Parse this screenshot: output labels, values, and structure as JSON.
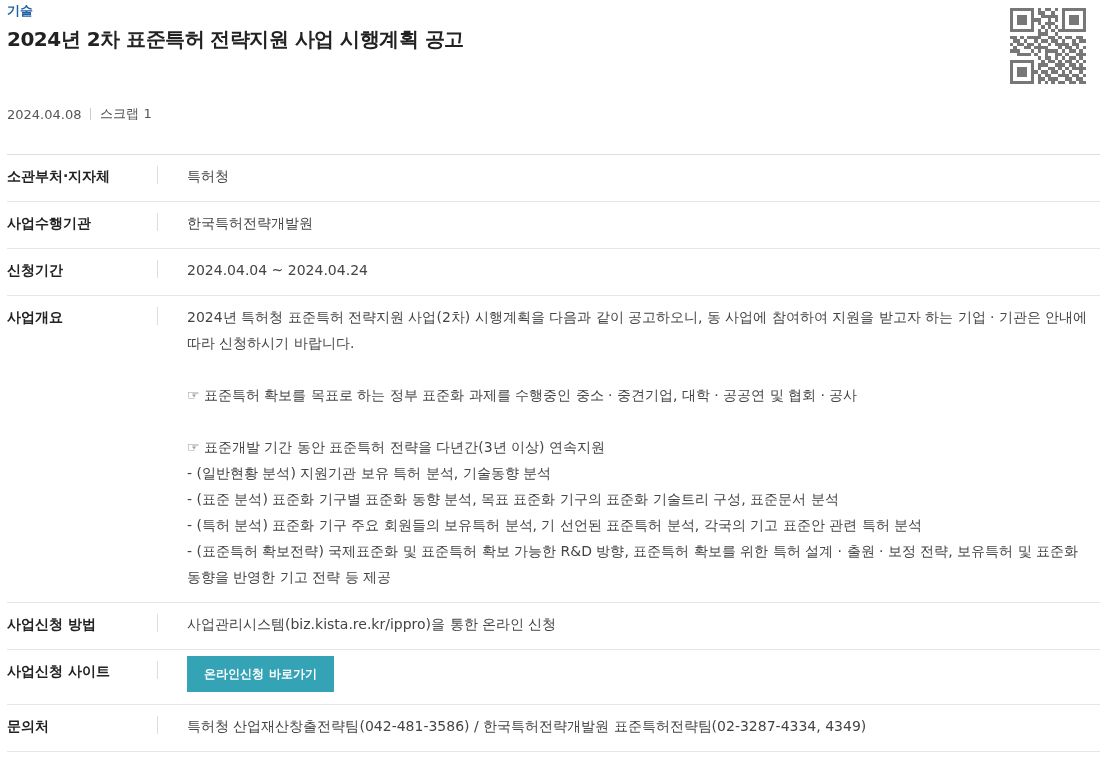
{
  "category": "기술",
  "title": "2024년 2차 표준특허 전략지원 사업 시행계획 공고",
  "date": "2024.04.08",
  "scrap": "스크랩 1",
  "rows": [
    {
      "kind": "text",
      "label": "소관부처·지자체",
      "blocks": [
        [
          "특허청"
        ]
      ]
    },
    {
      "kind": "text",
      "label": "사업수행기관",
      "blocks": [
        [
          "한국특허전략개발원"
        ]
      ]
    },
    {
      "kind": "text",
      "label": "신청기간",
      "blocks": [
        [
          "2024.04.04 ~ 2024.04.24"
        ]
      ]
    },
    {
      "kind": "text",
      "label": "사업개요",
      "blocks": [
        [
          "2024년 특허청 표준특허 전략지원 사업(2차) 시행계획을 다음과 같이 공고하오니, 동 사업에 참여하여 지원을 받고자 하는 기업 · 기관은 안내에 따라 신청하시기 바랍니다."
        ],
        [
          "☞ 표준특허 확보를 목표로 하는 정부 표준화 과제를 수행중인 중소 · 중견기업, 대학 · 공공연 및 협회 · 공사"
        ],
        [
          "☞ 표준개발 기간 동안 표준특허 전략을 다년간(3년 이상) 연속지원",
          "- (일반현황 분석) 지원기관 보유 특허 분석, 기술동향 분석",
          "- (표준 분석) 표준화 기구별 표준화 동향 분석, 목표 표준화 기구의 표준화 기술트리 구성, 표준문서 분석",
          "- (특허 분석) 표준화 기구 주요 회원들의 보유특허 분석, 기 선언된 표준특허 분석, 각국의 기고 표준안 관련 특허 분석",
          "- (표준특허 확보전략) 국제표준화 및 표준특허 확보 가능한 R&D 방향, 표준특허 확보를 위한 특허 설계 · 출원 · 보정 전략, 보유특허 및 표준화 동향을 반영한 기고 전략 등 제공"
        ]
      ]
    },
    {
      "kind": "text",
      "label": "사업신청 방법",
      "blocks": [
        [
          "사업관리시스템(biz.kista.re.kr/ippro)을 통한 온라인 신청"
        ]
      ]
    },
    {
      "kind": "button",
      "label": "사업신청 사이트",
      "button": "온라인신청 바로가기"
    },
    {
      "kind": "text",
      "label": "문의처",
      "blocks": [
        [
          "특허청 산업재산창출전략팀(042-481-3586) / 한국특허전략개발원 표준특허전략팀(02-3287-4334, 4349)"
        ]
      ]
    }
  ]
}
